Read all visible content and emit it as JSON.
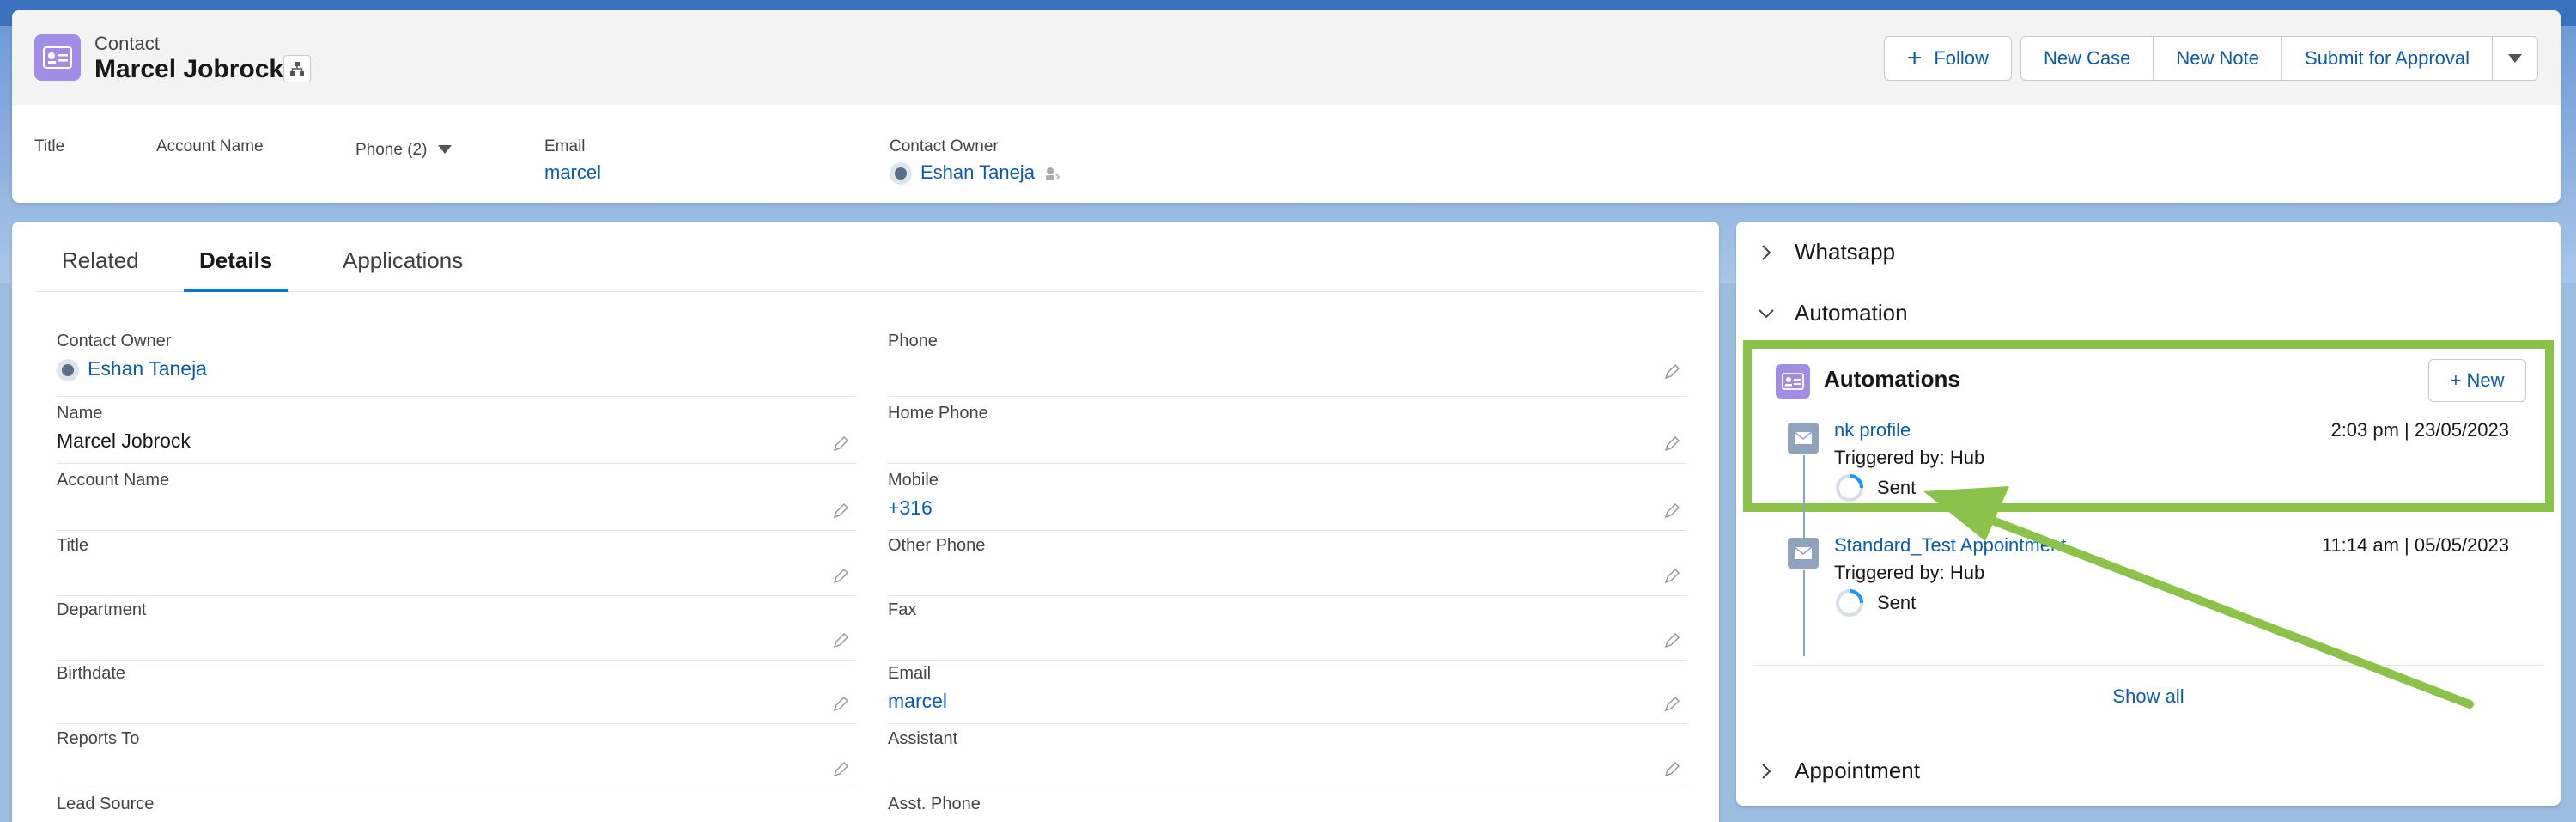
{
  "header": {
    "record_type": "Contact",
    "record_name": "Marcel Jobrock",
    "actions": {
      "follow": "Follow",
      "new_case": "New Case",
      "new_note": "New Note",
      "submit": "Submit for Approval"
    },
    "highlights": {
      "title_label": "Title",
      "account_label": "Account Name",
      "phone_label": "Phone (2)",
      "email_label": "Email",
      "email_value": "marcel",
      "owner_label": "Contact Owner",
      "owner_value": "Eshan Taneja"
    }
  },
  "tabs": [
    {
      "label": "Related"
    },
    {
      "label": "Details"
    },
    {
      "label": "Applications"
    }
  ],
  "details": {
    "left": [
      {
        "label": "Contact Owner",
        "value": "Eshan Taneja"
      },
      {
        "label": "Name",
        "value": "Marcel Jobrock"
      },
      {
        "label": "Account Name",
        "value": ""
      },
      {
        "label": "Title",
        "value": ""
      },
      {
        "label": "Department",
        "value": ""
      },
      {
        "label": "Birthdate",
        "value": ""
      },
      {
        "label": "Reports To",
        "value": ""
      },
      {
        "label": "Lead Source",
        "value": ""
      }
    ],
    "right": [
      {
        "label": "Phone",
        "value": ""
      },
      {
        "label": "Home Phone",
        "value": ""
      },
      {
        "label": "Mobile",
        "value": "+316"
      },
      {
        "label": "Other Phone",
        "value": ""
      },
      {
        "label": "Fax",
        "value": ""
      },
      {
        "label": "Email",
        "value": "marcel"
      },
      {
        "label": "Assistant",
        "value": ""
      },
      {
        "label": "Asst. Phone",
        "value": ""
      }
    ]
  },
  "sidebar": {
    "sections": {
      "whatsapp": "Whatsapp",
      "automation": "Automation",
      "appointment": "Appointment"
    },
    "automations": {
      "title": "Automations",
      "new_label": "+ New",
      "items": [
        {
          "name": "nk profile",
          "triggered": "Triggered by: Hub",
          "date": "2:03 pm | 23/05/2023",
          "status": "Sent"
        },
        {
          "name": "Standard_Test Appointment",
          "triggered": "Triggered by: Hub",
          "date": "11:14 am | 05/05/2023",
          "status": "Sent"
        }
      ],
      "show_all": "Show all"
    }
  },
  "colors": {
    "accent": "#0b5cab",
    "record_icon": "#9f8ee6",
    "highlight": "#8bc34a"
  }
}
